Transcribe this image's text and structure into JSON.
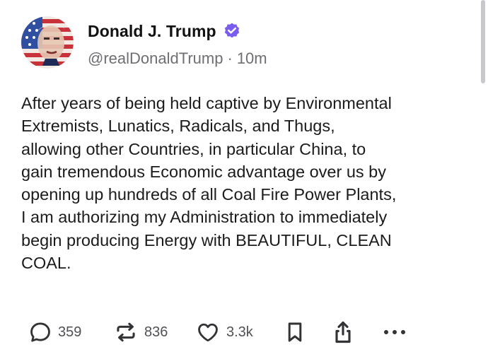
{
  "post": {
    "author": {
      "display_name": "Donald J. Trump",
      "handle": "@realDonaldTrump",
      "separator": "·",
      "time": "10m",
      "verified": true,
      "verified_color": "#7b5cf0"
    },
    "body_lines": [
      "After years of being held captive by Environmental",
      "Extremists, Lunatics, Radicals, and Thugs,",
      "allowing other Countries, in particular China, to",
      "gain tremendous Economic advantage over us by",
      "opening up hundreds of all Coal Fire Power Plants,",
      "I am authorizing my Administration to immediately",
      "begin producing Energy with BEAUTIFUL, CLEAN",
      "COAL."
    ],
    "actions": {
      "reply": {
        "icon": "comment-icon",
        "count": "359"
      },
      "repost": {
        "icon": "repost-icon",
        "count": "836"
      },
      "like": {
        "icon": "heart-icon",
        "count": "3.3k"
      },
      "bookmark": {
        "icon": "bookmark-icon"
      },
      "share": {
        "icon": "share-icon"
      },
      "more": {
        "icon": "more-icon"
      }
    }
  }
}
